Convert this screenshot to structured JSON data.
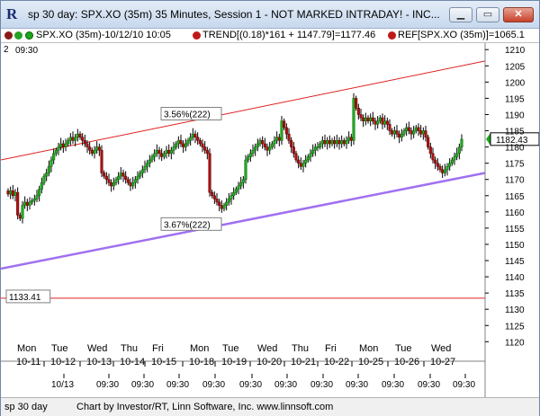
{
  "window": {
    "title": "sp 30 day: SPX.XO (35m) 35 Minutes, Session 1 - NOT MARKED INTRADAY! - INC...",
    "minimize_glyph": "▁",
    "maximize_glyph": "▭",
    "close_glyph": "✕"
  },
  "infobar": {
    "period_label": "SPX.XO (35m)-10/12/10 10:05",
    "trend_label": "TREND[(0.18)*161 + 1147.79]=1177.46",
    "ref_label": "REF[SPX.XO (35m)]=1065.1"
  },
  "time_label_num": "2",
  "time_label_time": "09:30",
  "colors": {
    "red_line": "#e02020",
    "purple_line": "#a070f0",
    "price_tag": "#1aa81a"
  },
  "chart_data": {
    "type": "candlestick",
    "ylim": [
      1114,
      1212
    ],
    "y_ticks": [
      1120,
      1125,
      1130,
      1135,
      1140,
      1145,
      1150,
      1155,
      1160,
      1165,
      1170,
      1175,
      1180,
      1185,
      1190,
      1195,
      1200,
      1205,
      1210
    ],
    "current_price": "1182.43",
    "ref_level_label": "1133.41",
    "ref_level": 1133.41,
    "upper_channel_label": "3.56%(222)",
    "lower_channel_label": "3.67%(222)",
    "upper_channel": {
      "start": 1176.0,
      "end": 1206.5
    },
    "lower_channel": {
      "start": 1142.5,
      "end": 1172.0
    },
    "days": [
      {
        "dow": "Mon",
        "date": "10-11"
      },
      {
        "dow": "Tue",
        "date": "10-12"
      },
      {
        "dow": "Wed",
        "date": "10-13"
      },
      {
        "dow": "Thu",
        "date": "10-14"
      },
      {
        "dow": "Fri",
        "date": "10-15"
      },
      {
        "dow": "Mon",
        "date": "10-18"
      },
      {
        "dow": "Tue",
        "date": "10-19"
      },
      {
        "dow": "Wed",
        "date": "10-20"
      },
      {
        "dow": "Thu",
        "date": "10-21"
      },
      {
        "dow": "Fri",
        "date": "10-22"
      },
      {
        "dow": "Mon",
        "date": "10-25"
      },
      {
        "dow": "Tue",
        "date": "10-26"
      },
      {
        "dow": "Wed",
        "date": "10-27"
      }
    ],
    "time_ticks": [
      "10/13",
      "09:30",
      "09:30",
      "09:30",
      "09:30",
      "09:30",
      "09:30",
      "09:30",
      "09:30",
      "09:30",
      "09:30",
      "09:30",
      "09:30"
    ],
    "closes": [
      1165.5,
      1166.5,
      1165,
      1166,
      1159,
      1158,
      1162,
      1163,
      1162,
      1163,
      1163.5,
      1164,
      1165,
      1167,
      1169,
      1171,
      1172,
      1174,
      1176,
      1178,
      1179,
      1180,
      1181,
      1180,
      1181,
      1182,
      1183,
      1182,
      1183,
      1184,
      1183,
      1182,
      1181,
      1180,
      1179,
      1178,
      1179,
      1180,
      1179,
      1172,
      1171,
      1170,
      1169,
      1168,
      1169,
      1170,
      1171,
      1172,
      1171,
      1170,
      1169,
      1168,
      1169,
      1170,
      1171,
      1172,
      1173,
      1174,
      1175,
      1176,
      1177,
      1178,
      1179,
      1178,
      1177,
      1178,
      1179,
      1178,
      1179,
      1180,
      1181,
      1182,
      1181,
      1180,
      1181,
      1182,
      1183,
      1184,
      1183,
      1182,
      1181,
      1180,
      1179,
      1178,
      1166,
      1165,
      1164,
      1163,
      1162,
      1161,
      1162,
      1163,
      1164,
      1165,
      1166,
      1167,
      1168,
      1169,
      1170,
      1176,
      1177,
      1178,
      1179,
      1180,
      1181,
      1182,
      1181,
      1180,
      1179,
      1180,
      1181,
      1182,
      1183,
      1182,
      1188,
      1186,
      1184,
      1182,
      1180,
      1178,
      1176,
      1175,
      1174,
      1175,
      1176,
      1177,
      1178,
      1179,
      1180,
      1180,
      1181,
      1182,
      1181,
      1182,
      1181,
      1182,
      1181,
      1182,
      1181,
      1182,
      1181,
      1182,
      1183,
      1182,
      1195,
      1192,
      1190,
      1189,
      1188,
      1189,
      1188,
      1189,
      1188,
      1187,
      1188,
      1189,
      1187,
      1188,
      1187,
      1185,
      1184,
      1185,
      1184,
      1183,
      1184,
      1185,
      1186,
      1185,
      1184,
      1185,
      1186,
      1185,
      1184,
      1185,
      1183,
      1180,
      1178,
      1176,
      1175,
      1174,
      1173,
      1172,
      1173,
      1174,
      1175,
      1176,
      1177,
      1178,
      1180,
      1182.4
    ]
  },
  "status": {
    "left": "sp 30 day",
    "credit": "Chart by Investor/RT, Linn Software, Inc. www.linnsoft.com"
  }
}
